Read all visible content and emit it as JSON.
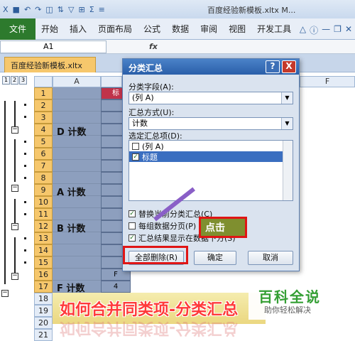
{
  "window": {
    "title": "百度经验新模板.xltx M..."
  },
  "ribbon": {
    "file": "文件",
    "tabs": [
      "开始",
      "插入",
      "页面布局",
      "公式",
      "数据",
      "审阅",
      "视图",
      "开发工具"
    ]
  },
  "formula_bar": {
    "name_box": "A1",
    "fx": "fx"
  },
  "workbook_tab": "百度经验新模板.xltx",
  "outline_levels": [
    "1",
    "2",
    "3"
  ],
  "columns": [
    "A",
    "F"
  ],
  "rows": [
    {
      "num": "1",
      "b": "标"
    },
    {
      "num": "2",
      "b": ""
    },
    {
      "num": "3",
      "b": ""
    },
    {
      "num": "4",
      "b": ""
    },
    {
      "num": "5",
      "b": ""
    },
    {
      "num": "6",
      "b": ""
    },
    {
      "num": "7",
      "b": ""
    },
    {
      "num": "8",
      "b": ""
    },
    {
      "num": "9",
      "b": ""
    },
    {
      "num": "10",
      "b": ""
    },
    {
      "num": "11",
      "b": ""
    },
    {
      "num": "12",
      "b": ""
    },
    {
      "num": "13",
      "b": ""
    },
    {
      "num": "14",
      "b": ""
    },
    {
      "num": "15",
      "b": ""
    },
    {
      "num": "16",
      "b": "F"
    },
    {
      "num": "17",
      "b": "4"
    },
    {
      "num": "18",
      "b": ""
    },
    {
      "num": "19",
      "b": ""
    },
    {
      "num": "20",
      "b": ""
    },
    {
      "num": "21",
      "b": ""
    }
  ],
  "group_labels": [
    {
      "text": "D 计数"
    },
    {
      "text": "A 计数"
    },
    {
      "text": "B 计数"
    },
    {
      "text": "F 计数"
    }
  ],
  "dialog": {
    "title": "分类汇总",
    "help": "?",
    "close": "X",
    "field_label": "分类字段(A):",
    "field_value": "(列 A)",
    "method_label": "汇总方式(U):",
    "method_value": "计数",
    "items_label": "选定汇总项(D):",
    "items": [
      {
        "label": "(列 A)",
        "checked": false
      },
      {
        "label": "标题",
        "checked": true
      }
    ],
    "options": [
      {
        "label": "替换当前分类汇总(C)",
        "checked": true
      },
      {
        "label": "每组数据分页(P)",
        "checked": false
      },
      {
        "label": "汇总结果显示在数据下方(S)",
        "checked": true
      }
    ],
    "remove_all": "全部删除(R)",
    "ok": "确定",
    "cancel": "取消"
  },
  "annotation": {
    "callout": "点击"
  },
  "banner": {
    "text": "如何合并同类项-分类汇总"
  },
  "watermark": {
    "big": "百科全说",
    "small": "助你轻松解决"
  },
  "colors": {
    "file_tab": "#2d7a2d",
    "row_header": "#f6c76c",
    "highlight": "#e01515",
    "dialog_title": "#2a5fa9"
  }
}
